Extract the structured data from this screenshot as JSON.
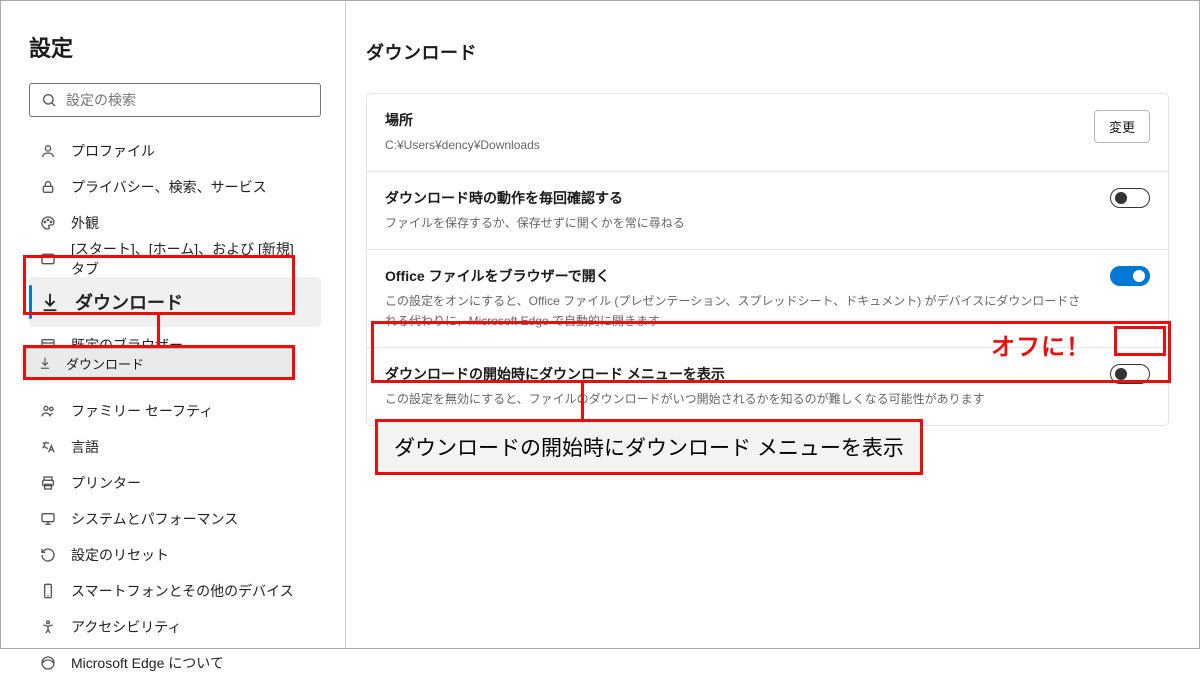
{
  "sidebar": {
    "title": "設定",
    "search_placeholder": "設定の検索",
    "items": [
      {
        "label": "プロファイル"
      },
      {
        "label": "プライバシー、検索、サービス"
      },
      {
        "label": "外観"
      },
      {
        "label": "[スタート]、[ホーム]、および [新規] タブ"
      },
      {
        "label": "ダウンロード"
      },
      {
        "label": "既定のブラウザー"
      },
      {
        "label": "ファミリー セーフティ"
      },
      {
        "label": "言語"
      },
      {
        "label": "プリンター"
      },
      {
        "label": "システムとパフォーマンス"
      },
      {
        "label": "設定のリセット"
      },
      {
        "label": "スマートフォンとその他のデバイス"
      },
      {
        "label": "アクセシビリティ"
      },
      {
        "label": "Microsoft Edge について"
      }
    ]
  },
  "dropdown_extra": {
    "label": "ダウンロード"
  },
  "main": {
    "heading": "ダウンロード",
    "location": {
      "title": "場所",
      "path": "C:¥Users¥dency¥Downloads",
      "button": "変更"
    },
    "confirm": {
      "title": "ダウンロード時の動作を毎回確認する",
      "sub": "ファイルを保存するか、保存せずに開くかを常に尋ねる"
    },
    "office": {
      "title": "Office ファイルをブラウザーで開く",
      "sub": "この設定をオンにすると、Office ファイル (プレゼンテーション、スプレッドシート、ドキュメント) がデバイスにダウンロードされる代わりに、Microsoft Edge で自動的に開きます"
    },
    "showmenu": {
      "title": "ダウンロードの開始時にダウンロード メニューを表示",
      "sub": "この設定を無効にすると、ファイルのダウンロードがいつ開始されるかを知るのが難しくなる可能性があります"
    }
  },
  "annotations": {
    "off_label": "オフに！",
    "callout_text": "ダウンロードの開始時にダウンロード メニューを表示"
  }
}
